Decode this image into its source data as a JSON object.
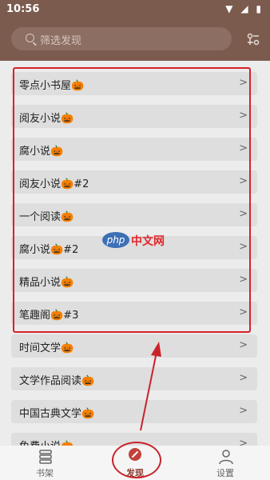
{
  "status": {
    "time": "10:56",
    "icons": "▼ ◢ ▮"
  },
  "search": {
    "placeholder": "筛选发现"
  },
  "sources": [
    "零点小书屋🎃",
    "阅友小说🎃",
    "腐小说🎃",
    "阅友小说🎃#2",
    "一个阅读🎃",
    "腐小说🎃#2",
    "精品小说🎃",
    "笔趣阁🎃#3",
    "时间文学🎃",
    "文学作品阅读🎃",
    "中国古典文学🎃",
    "免费小说🎃"
  ],
  "chevron": ">",
  "watermark": {
    "logo": "php",
    "text": "中文网"
  },
  "nav": {
    "bookshelf": "书架",
    "discover": "发现",
    "settings": "设置"
  },
  "colors": {
    "accent": "#7b5b4e",
    "highlight": "#d9202a"
  }
}
